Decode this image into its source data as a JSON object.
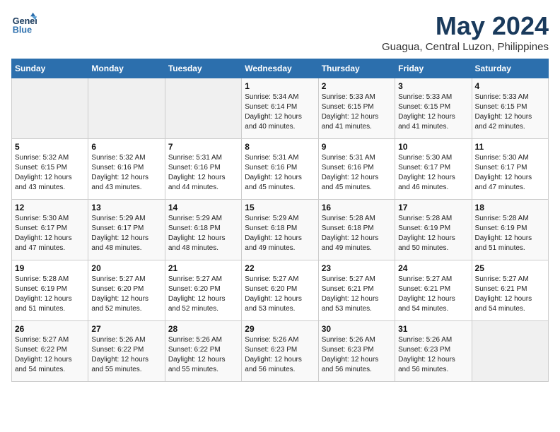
{
  "logo": {
    "line1": "General",
    "line2": "Blue"
  },
  "title": "May 2024",
  "location": "Guagua, Central Luzon, Philippines",
  "days_header": [
    "Sunday",
    "Monday",
    "Tuesday",
    "Wednesday",
    "Thursday",
    "Friday",
    "Saturday"
  ],
  "weeks": [
    [
      {
        "day": "",
        "info": ""
      },
      {
        "day": "",
        "info": ""
      },
      {
        "day": "",
        "info": ""
      },
      {
        "day": "1",
        "info": "Sunrise: 5:34 AM\nSunset: 6:14 PM\nDaylight: 12 hours\nand 40 minutes."
      },
      {
        "day": "2",
        "info": "Sunrise: 5:33 AM\nSunset: 6:15 PM\nDaylight: 12 hours\nand 41 minutes."
      },
      {
        "day": "3",
        "info": "Sunrise: 5:33 AM\nSunset: 6:15 PM\nDaylight: 12 hours\nand 41 minutes."
      },
      {
        "day": "4",
        "info": "Sunrise: 5:33 AM\nSunset: 6:15 PM\nDaylight: 12 hours\nand 42 minutes."
      }
    ],
    [
      {
        "day": "5",
        "info": "Sunrise: 5:32 AM\nSunset: 6:15 PM\nDaylight: 12 hours\nand 43 minutes."
      },
      {
        "day": "6",
        "info": "Sunrise: 5:32 AM\nSunset: 6:16 PM\nDaylight: 12 hours\nand 43 minutes."
      },
      {
        "day": "7",
        "info": "Sunrise: 5:31 AM\nSunset: 6:16 PM\nDaylight: 12 hours\nand 44 minutes."
      },
      {
        "day": "8",
        "info": "Sunrise: 5:31 AM\nSunset: 6:16 PM\nDaylight: 12 hours\nand 45 minutes."
      },
      {
        "day": "9",
        "info": "Sunrise: 5:31 AM\nSunset: 6:16 PM\nDaylight: 12 hours\nand 45 minutes."
      },
      {
        "day": "10",
        "info": "Sunrise: 5:30 AM\nSunset: 6:17 PM\nDaylight: 12 hours\nand 46 minutes."
      },
      {
        "day": "11",
        "info": "Sunrise: 5:30 AM\nSunset: 6:17 PM\nDaylight: 12 hours\nand 47 minutes."
      }
    ],
    [
      {
        "day": "12",
        "info": "Sunrise: 5:30 AM\nSunset: 6:17 PM\nDaylight: 12 hours\nand 47 minutes."
      },
      {
        "day": "13",
        "info": "Sunrise: 5:29 AM\nSunset: 6:17 PM\nDaylight: 12 hours\nand 48 minutes."
      },
      {
        "day": "14",
        "info": "Sunrise: 5:29 AM\nSunset: 6:18 PM\nDaylight: 12 hours\nand 48 minutes."
      },
      {
        "day": "15",
        "info": "Sunrise: 5:29 AM\nSunset: 6:18 PM\nDaylight: 12 hours\nand 49 minutes."
      },
      {
        "day": "16",
        "info": "Sunrise: 5:28 AM\nSunset: 6:18 PM\nDaylight: 12 hours\nand 49 minutes."
      },
      {
        "day": "17",
        "info": "Sunrise: 5:28 AM\nSunset: 6:19 PM\nDaylight: 12 hours\nand 50 minutes."
      },
      {
        "day": "18",
        "info": "Sunrise: 5:28 AM\nSunset: 6:19 PM\nDaylight: 12 hours\nand 51 minutes."
      }
    ],
    [
      {
        "day": "19",
        "info": "Sunrise: 5:28 AM\nSunset: 6:19 PM\nDaylight: 12 hours\nand 51 minutes."
      },
      {
        "day": "20",
        "info": "Sunrise: 5:27 AM\nSunset: 6:20 PM\nDaylight: 12 hours\nand 52 minutes."
      },
      {
        "day": "21",
        "info": "Sunrise: 5:27 AM\nSunset: 6:20 PM\nDaylight: 12 hours\nand 52 minutes."
      },
      {
        "day": "22",
        "info": "Sunrise: 5:27 AM\nSunset: 6:20 PM\nDaylight: 12 hours\nand 53 minutes."
      },
      {
        "day": "23",
        "info": "Sunrise: 5:27 AM\nSunset: 6:21 PM\nDaylight: 12 hours\nand 53 minutes."
      },
      {
        "day": "24",
        "info": "Sunrise: 5:27 AM\nSunset: 6:21 PM\nDaylight: 12 hours\nand 54 minutes."
      },
      {
        "day": "25",
        "info": "Sunrise: 5:27 AM\nSunset: 6:21 PM\nDaylight: 12 hours\nand 54 minutes."
      }
    ],
    [
      {
        "day": "26",
        "info": "Sunrise: 5:27 AM\nSunset: 6:22 PM\nDaylight: 12 hours\nand 54 minutes."
      },
      {
        "day": "27",
        "info": "Sunrise: 5:26 AM\nSunset: 6:22 PM\nDaylight: 12 hours\nand 55 minutes."
      },
      {
        "day": "28",
        "info": "Sunrise: 5:26 AM\nSunset: 6:22 PM\nDaylight: 12 hours\nand 55 minutes."
      },
      {
        "day": "29",
        "info": "Sunrise: 5:26 AM\nSunset: 6:23 PM\nDaylight: 12 hours\nand 56 minutes."
      },
      {
        "day": "30",
        "info": "Sunrise: 5:26 AM\nSunset: 6:23 PM\nDaylight: 12 hours\nand 56 minutes."
      },
      {
        "day": "31",
        "info": "Sunrise: 5:26 AM\nSunset: 6:23 PM\nDaylight: 12 hours\nand 56 minutes."
      },
      {
        "day": "",
        "info": ""
      }
    ]
  ]
}
